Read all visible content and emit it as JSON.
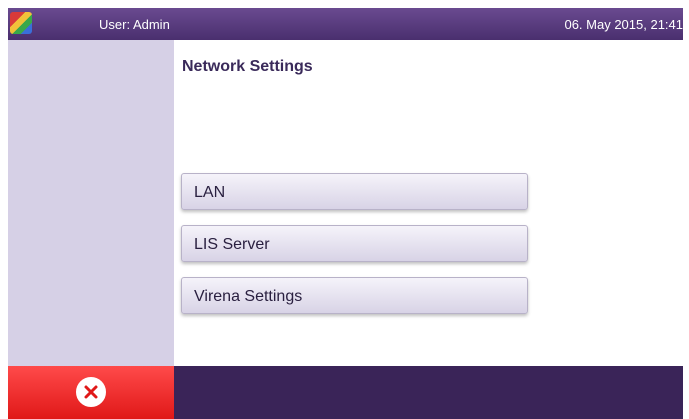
{
  "header": {
    "user_label": "User: Admin",
    "datetime": "06. May 2015, 21:41",
    "logo_icon": "app-logo-icon"
  },
  "main": {
    "title": "Network Settings",
    "menu": [
      {
        "label": "LAN"
      },
      {
        "label": "LIS Server"
      },
      {
        "label": "Virena Settings"
      }
    ]
  },
  "footer": {
    "close_icon": "close-icon"
  },
  "colors": {
    "header": "#4a2f6e",
    "sidebar": "#d6d0e6",
    "footer": "#3a2458",
    "close_button": "#e01818"
  }
}
